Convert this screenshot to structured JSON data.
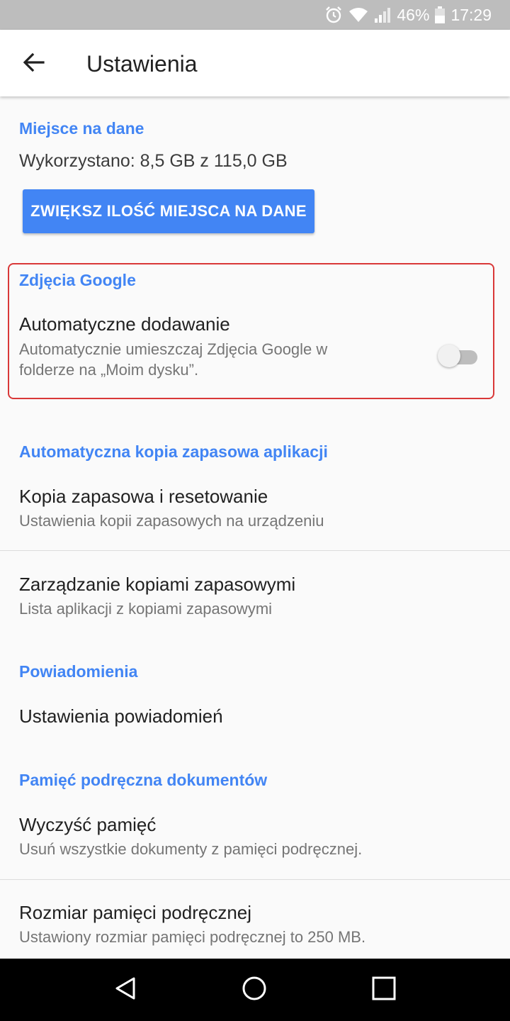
{
  "status_bar": {
    "battery_percent": "46%",
    "time": "17:29",
    "icons": [
      "alarm-icon",
      "wifi-icon",
      "signal-icon",
      "battery-icon"
    ]
  },
  "app_bar": {
    "title": "Ustawienia",
    "back_icon": "back-arrow-icon"
  },
  "storage": {
    "header": "Miejsce na dane",
    "used_text": "Wykorzystano: 8,5 GB z 115,0 GB",
    "button_label": "ZWIĘKSZ ILOŚĆ MIEJSCA NA DANE"
  },
  "google_photos": {
    "header": "Zdjęcia Google",
    "auto_add_title": "Automatyczne dodawanie",
    "auto_add_sub_line1": "Automatycznie umieszczaj Zdjęcia Google w",
    "auto_add_sub_line2": "folderze na „Moim dysku”.",
    "toggle_on": false
  },
  "app_backup": {
    "header": "Automatyczna kopia zapasowa aplikacji",
    "items": [
      {
        "title": "Kopia zapasowa i resetowanie",
        "subtitle": "Ustawienia kopii zapasowych na urządzeniu"
      },
      {
        "title": "Zarządzanie kopiami zapasowymi",
        "subtitle": "Lista aplikacji z kopiami zapasowymi"
      }
    ]
  },
  "notifications": {
    "header": "Powiadomienia",
    "item_title": "Ustawienia powiadomień"
  },
  "doc_cache": {
    "header": "Pamięć podręczna dokumentów",
    "items": [
      {
        "title": "Wyczyść pamięć",
        "subtitle": "Usuń wszystkie dokumenty z pamięci podręcznej."
      },
      {
        "title": "Rozmiar pamięci podręcznej",
        "subtitle": "Ustawiony rozmiar pamięci podręcznej to 250 MB."
      }
    ]
  },
  "colors": {
    "accent": "#4285f4",
    "highlight_border": "#d93838",
    "status_bar": "#bdbdbd",
    "nav_bar": "#000000"
  },
  "nav_bar": {
    "icons": [
      "back-triangle-icon",
      "home-circle-icon",
      "recents-square-icon"
    ]
  }
}
